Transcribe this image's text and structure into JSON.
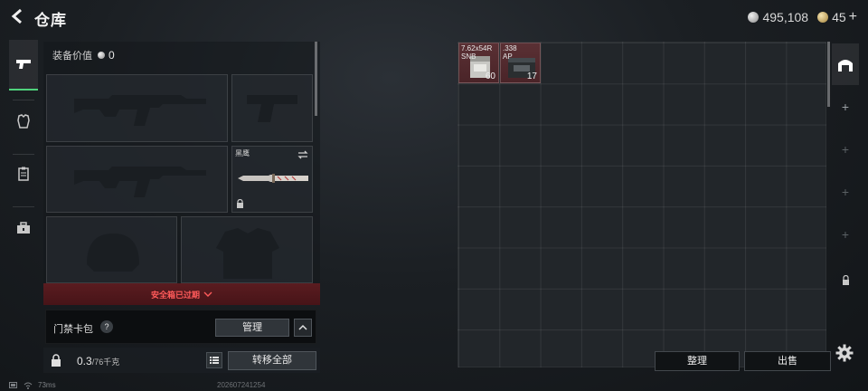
{
  "header": {
    "title": "仓库",
    "silver_amount": "495,108",
    "gold_amount": "45",
    "gold_add": "+"
  },
  "sidebar": {
    "tabs": [
      {
        "icon": "pistol-icon",
        "active": true
      },
      {
        "icon": "armor-icon",
        "active": false
      },
      {
        "icon": "clipboard-icon",
        "active": false
      },
      {
        "icon": "toolbox-icon",
        "active": false
      }
    ]
  },
  "equipment": {
    "value_label": "装备价值",
    "value_amount": "0",
    "knife_name": "黑鹰",
    "slots": [
      "primary-weapon-slot",
      "pistol-slot",
      "secondary-weapon-slot",
      "melee-slot",
      "helmet-slot",
      "armor-slot"
    ]
  },
  "secure_case": {
    "banner_text": "安全箱已过期"
  },
  "keycard": {
    "label": "门禁卡包",
    "help": "?",
    "manage_label": "管理"
  },
  "weight": {
    "current": "0.3",
    "capacity": "/76千克",
    "transfer_label": "转移全部"
  },
  "stash": {
    "items": [
      {
        "name": "7.62x54R\nSNB",
        "count": "60"
      },
      {
        "name": ".338\nAP",
        "count": "17"
      }
    ],
    "sort_label": "整理",
    "sell_label": "出售"
  },
  "right_tabs": {
    "plus": "+"
  },
  "status": {
    "latency": "73ms",
    "build": "202607241254"
  },
  "colors": {
    "accent_green": "#4fd27c",
    "warning_red": "#ff5a5a",
    "item_background": "#5a3034"
  }
}
